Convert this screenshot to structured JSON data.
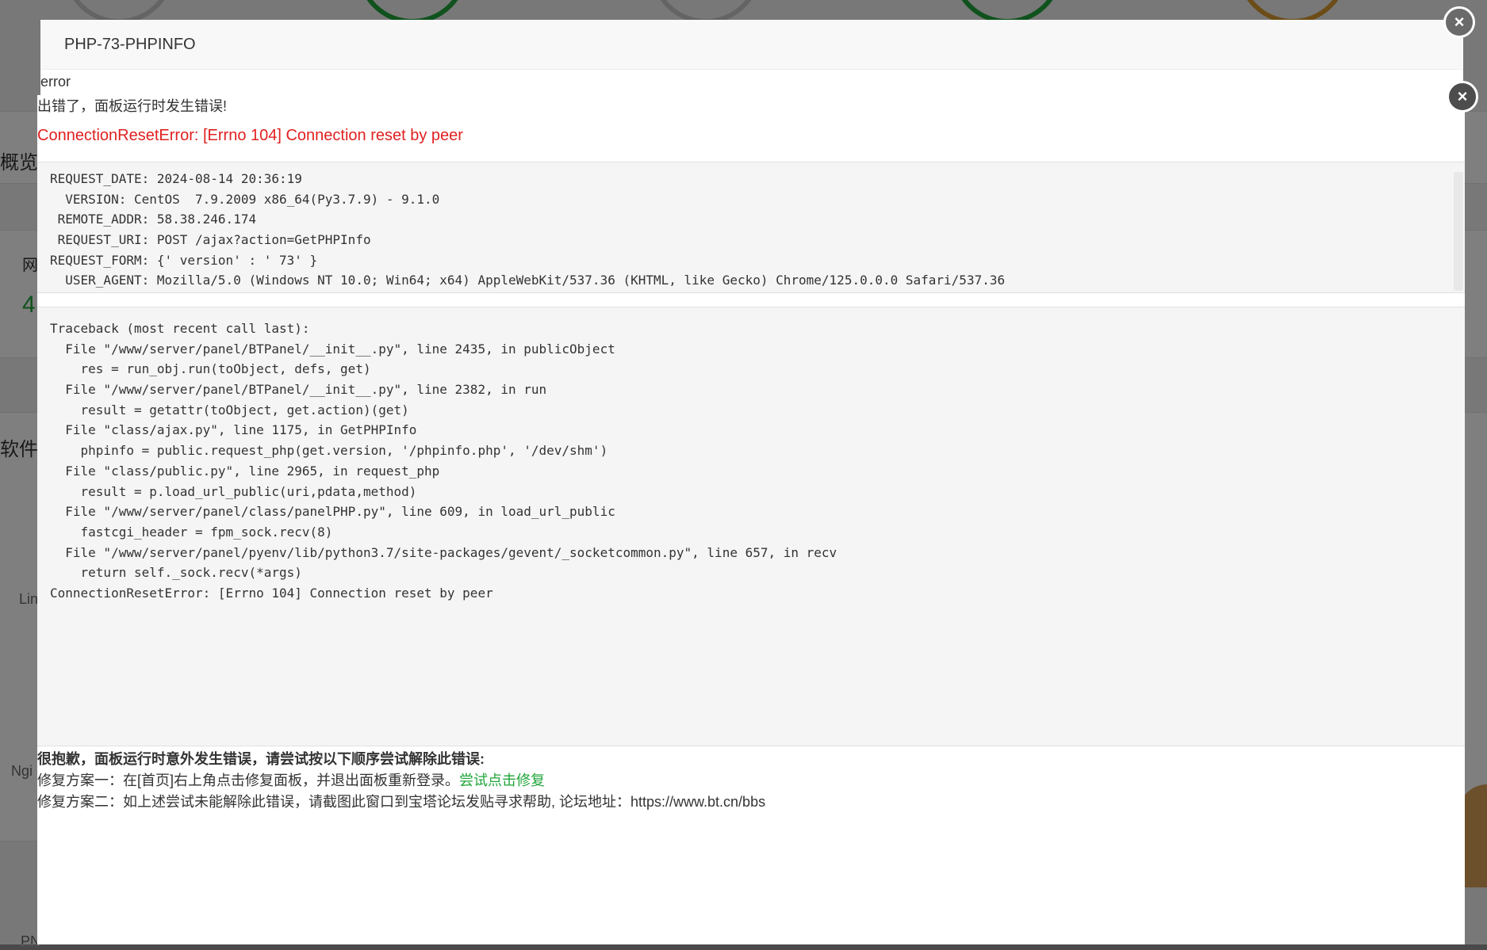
{
  "background": {
    "labels": [
      "概览",
      "网",
      "软件",
      "Lin",
      "Ngi",
      "PN"
    ],
    "number": "4"
  },
  "dialog": {
    "title": "PHP-73-PHPINFO",
    "error_label": "error",
    "close_symbol": "×"
  },
  "error_dialog": {
    "close_symbol": "×",
    "header": "出错了，面板运行时发生错误!",
    "message": "ConnectionResetError: [Errno 104] Connection reset by peer",
    "info_lines": [
      "REQUEST_DATE: 2024-08-14 20:36:19",
      "  VERSION: CentOS  7.9.2009 x86_64(Py3.7.9) - 9.1.0",
      " REMOTE_ADDR: 58.38.246.174",
      " REQUEST_URI: POST /ajax?action=GetPHPInfo",
      "REQUEST_FORM: {' version' : ' 73' }",
      "  USER_AGENT: Mozilla/5.0 (Windows NT 10.0; Win64; x64) AppleWebKit/537.36 (KHTML, like Gecko) Chrome/125.0.0.0 Safari/537.36"
    ],
    "traceback_lines": [
      "Traceback (most recent call last):",
      "  File \"/www/server/panel/BTPanel/__init__.py\", line 2435, in publicObject",
      "    res = run_obj.run(toObject, defs, get)",
      "  File \"/www/server/panel/BTPanel/__init__.py\", line 2382, in run",
      "    result = getattr(toObject, get.action)(get)",
      "  File \"class/ajax.py\", line 1175, in GetPHPInfo",
      "    phpinfo = public.request_php(get.version, '/phpinfo.php', '/dev/shm')",
      "  File \"class/public.py\", line 2965, in request_php",
      "    result = p.load_url_public(uri,pdata,method)",
      "  File \"/www/server/panel/class/panelPHP.py\", line 609, in load_url_public",
      "    fastcgi_header = fpm_sock.recv(8)",
      "  File \"/www/server/panel/pyenv/lib/python3.7/site-packages/gevent/_socketcommon.py\", line 657, in recv",
      "    return self._sock.recv(*args)",
      "ConnectionResetError: [Errno 104] Connection reset by peer"
    ],
    "help_title": "很抱歉，面板运行时意外发生错误，请尝试按以下顺序尝试解除此错误:",
    "fix1_text": "修复方案一：在[首页]右上角点击修复面板，并退出面板重新登录。",
    "fix1_link": "尝试点击修复",
    "fix2_text": "修复方案二：如上述尝试未能解除此错误，请截图此窗口到宝塔论坛发贴寻求帮助, 论坛地址：https://www.bt.cn/bbs"
  },
  "colors": {
    "error_red": "#e02020",
    "link_green": "#20a53a",
    "overlay": "#000000"
  }
}
